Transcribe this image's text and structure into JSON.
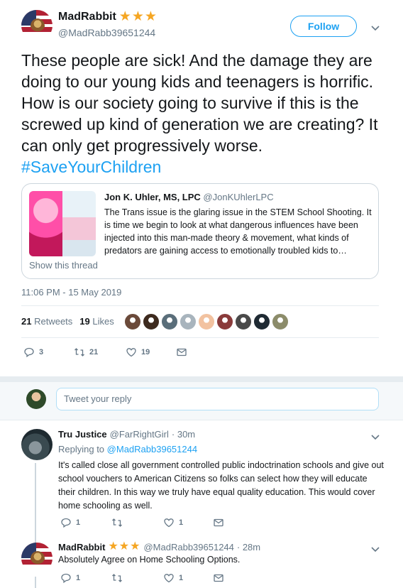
{
  "main_tweet": {
    "name": "MadRabbit",
    "badge": "★★★",
    "handle": "@MadRabb39651244",
    "follow_label": "Follow",
    "text": "These people are sick! And the damage they are doing to our young kids and teenagers is horrific. How is our society going to survive if this is the screwed up kind of generation we are creating? It can only get progressively worse. ",
    "hashtag": "#SaveYourChildren",
    "quote": {
      "name": "Jon K. Uhler, MS, LPC",
      "handle": "@JonKUhlerLPC",
      "text": "The Trans issue is the glaring issue in the STEM School Shooting. It is time we begin to look at what dangerous influences have been injected into this man-made theory & movement, what kinds of predators are gaining access to emotionally troubled kids to…",
      "show_thread": "Show this thread"
    },
    "timestamp": "11:06 PM - 15 May 2019",
    "stats": {
      "retweets_count": "21",
      "retweets_label": "Retweets",
      "likes_count": "19",
      "likes_label": "Likes"
    },
    "actions": {
      "replies": "3",
      "retweets": "21",
      "likes": "19"
    }
  },
  "liker_colors": [
    "#6b4a3a",
    "#3d2a1e",
    "#5a6e7a",
    "#a8b4bd",
    "#f2c2a0",
    "#8a3b3b",
    "#4a4a4a",
    "#1f2a33",
    "#8c8c6a"
  ],
  "reply_box": {
    "placeholder": "Tweet your reply"
  },
  "replies": [
    {
      "name": "Tru Justice",
      "handle": "@FarRightGirl",
      "time": "· 30m",
      "replying_prefix": "Replying to",
      "replying_to": "@MadRabb39651244",
      "text": "It's called close all government controlled public indoctrination schools and give out school vouchers to American Citizens so folks can select how they will educate their children. In this way we truly have equal quality education. This would cover home schooling as well.",
      "replies_count": "1",
      "likes_count": "1"
    },
    {
      "name": "MadRabbit",
      "badge": "★★★",
      "handle": "@MadRabb39651244",
      "time": "· 28m",
      "text": "Absolutely Agree on Home Schooling Options.",
      "replies_count": "1",
      "likes_count": "1"
    }
  ]
}
